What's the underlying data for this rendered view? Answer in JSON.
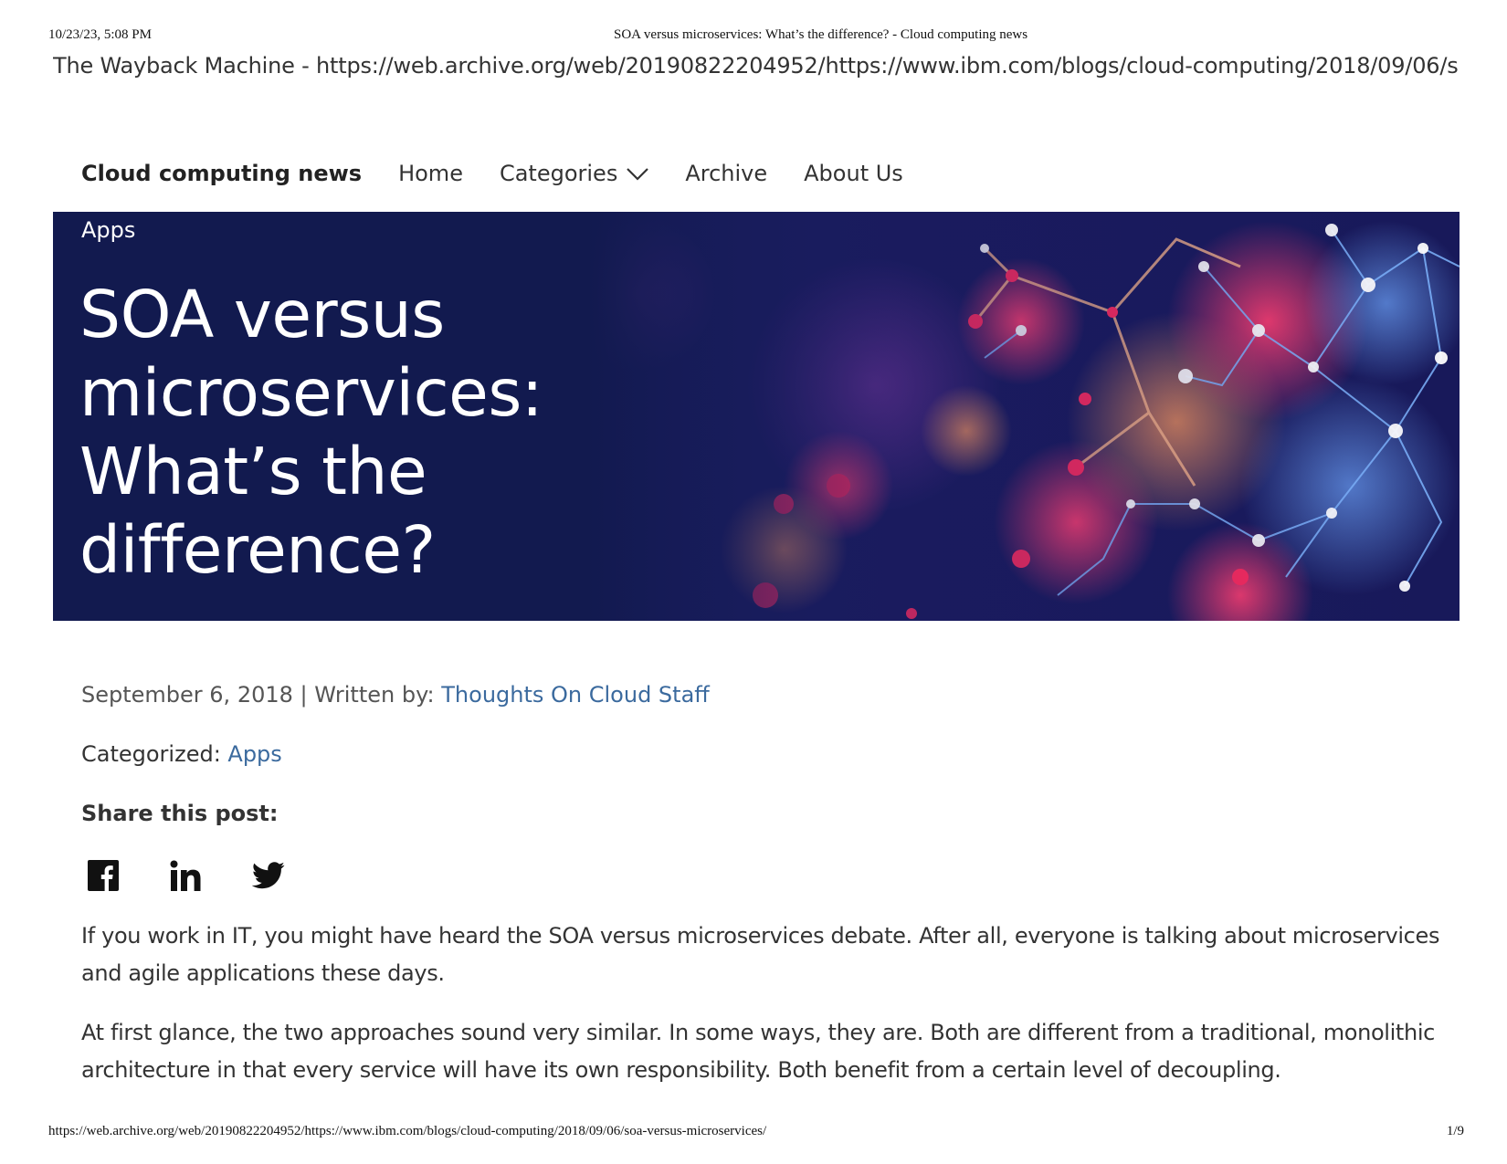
{
  "print_header": {
    "datetime": "10/23/23, 5:08 PM",
    "title": "SOA versus microservices: What’s the difference? - Cloud computing news"
  },
  "wayback_bar": "The Wayback Machine - https://web.archive.org/web/20190822204952/https://www.ibm.com/blogs/cloud-computing/2018/09/06/s...",
  "nav": {
    "brand": "Cloud computing news",
    "items": [
      "Home",
      "Categories",
      "Archive",
      "About Us"
    ],
    "categories_icon": "chevron-down-icon"
  },
  "hero": {
    "tag": "Apps",
    "title": "SOA versus microservices: What’s the difference?",
    "background_color": "#121a4f"
  },
  "meta": {
    "date": "September 6, 2018",
    "separator": " | Written by: ",
    "author": "Thoughts On Cloud Staff",
    "categorized_label": "Categorized: ",
    "category": "Apps",
    "link_color": "#3b6a9e"
  },
  "share": {
    "label": "Share this post:",
    "icons": [
      "facebook-icon",
      "linkedin-icon",
      "twitter-icon"
    ]
  },
  "body": {
    "paragraphs": [
      "If you work in IT, you might have heard the SOA versus microservices debate. After all, everyone is talking about microservices and agile applications these days.",
      "At first glance, the two approaches sound very similar. In some ways, they are. Both are different from a traditional, monolithic architecture in that every service will have its own responsibility. Both benefit from a certain level of decoupling."
    ]
  },
  "print_footer": {
    "url": "https://web.archive.org/web/20190822204952/https://www.ibm.com/blogs/cloud-computing/2018/09/06/soa-versus-microservices/",
    "page": "1/9"
  }
}
